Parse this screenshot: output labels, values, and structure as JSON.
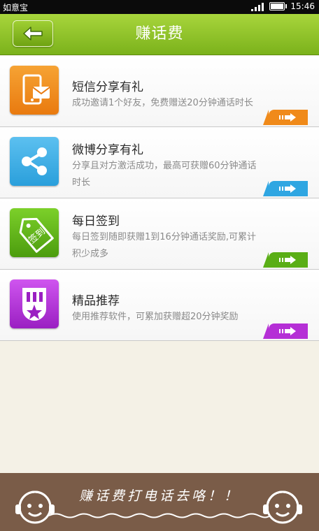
{
  "status_bar": {
    "app_name": "如意宝",
    "time": "15:46"
  },
  "header": {
    "title": "赚话费"
  },
  "items": [
    {
      "title": "短信分享有礼",
      "description": "成功邀请1个好友，免费赠送20分钟通话时长",
      "color": "#f08a1a"
    },
    {
      "title": "微博分享有礼",
      "description": "分享且对方激活成功，最高可获赠60分钟通话时长",
      "color": "#2fa6e2"
    },
    {
      "title": "每日签到",
      "description": "每日签到随即获赠1到16分钟通话奖励,可累计积少成多",
      "color": "#5aae16",
      "icon_text": "签到"
    },
    {
      "title": "精品推荐",
      "description": "使用推荐软件，可累加获赠超20分钟奖励",
      "color": "#b52fd6"
    }
  ],
  "footer": {
    "slogan": "赚话费打电话去咯！！"
  },
  "icons": [
    "back-arrow-icon",
    "sms-share-icon",
    "share-icon",
    "sign-in-tag-icon",
    "medal-star-icon",
    "arrow-right-icon",
    "smiley-headphone-icon"
  ]
}
